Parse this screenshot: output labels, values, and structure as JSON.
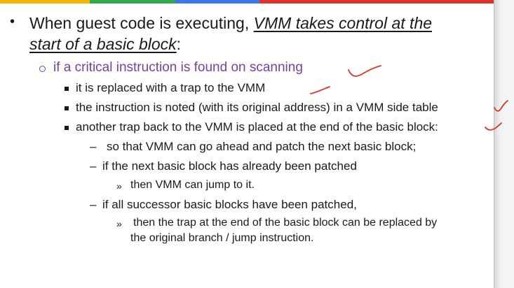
{
  "slide": {
    "bullet1": {
      "text_before": "When guest code is executing, ",
      "text_emph_line1": "VMM takes control at the",
      "text_emph_line2": "start of a basic block",
      "text_after": ":"
    },
    "bullet2": {
      "text": "if a critical instruction is found on scanning"
    },
    "sub_items": [
      {
        "text": "it is replaced with a trap to the VMM"
      },
      {
        "text": "the instruction is noted (with its original address) in a VMM side table"
      },
      {
        "text": "another trap back to the VMM is placed at the end of the basic block:"
      }
    ],
    "dash_items": [
      {
        "text": "so that VMM can go ahead and patch the next basic block;"
      },
      {
        "text": "if the next basic block has already been patched"
      },
      {
        "text": "if all successor basic blocks have been patched,"
      }
    ],
    "raquo_items": [
      {
        "text": "then VMM can jump to it."
      },
      {
        "text": "then the trap at the end of the basic block can be replaced by"
      },
      {
        "text": "the original branch / jump instruction."
      }
    ]
  },
  "colors": {
    "purple": "#7b3f9e",
    "annotation_red": "#d9342b",
    "bar_yellow": "#f4b400",
    "bar_green": "#2eaa4d",
    "bar_blue": "#3b78e7",
    "bar_red": "#e0322b"
  }
}
